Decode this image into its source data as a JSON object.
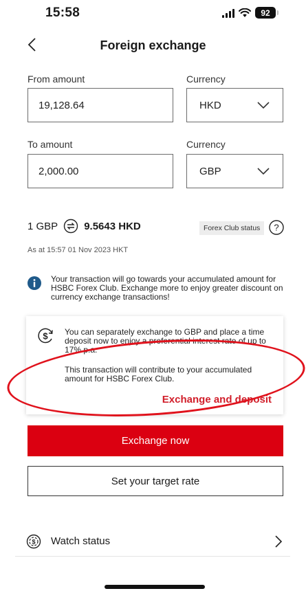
{
  "status_bar": {
    "time": "15:58",
    "battery": "92"
  },
  "header": {
    "title": "Foreign exchange"
  },
  "from": {
    "label": "From amount",
    "value": "19,128.64",
    "currency_label": "Currency",
    "currency": "HKD"
  },
  "to": {
    "label": "To amount",
    "value": "2,000.00",
    "currency_label": "Currency",
    "currency": "GBP"
  },
  "rate": {
    "from": "1 GBP",
    "to": "9.5643 HKD",
    "as_at": "As at 15:57 01 Nov 2023 HKT",
    "club_status": "Forex Club status"
  },
  "info": {
    "text": "Your transaction will go towards your accumulated amount for HSBC Forex Club. Exchange more to enjoy greater discount on currency exchange transactions!"
  },
  "promo": {
    "text1": "You can separately exchange to GBP and place a time deposit now to enjoy a preferential interest rate of up to 17% p.a.",
    "text2": "This transaction will contribute to your accumulated amount for HSBC Forex Club.",
    "link": "Exchange and deposit"
  },
  "buttons": {
    "exchange_now": "Exchange now",
    "target_rate": "Set your target rate"
  },
  "watch": {
    "label": "Watch status"
  },
  "colors": {
    "accent": "#db0011",
    "annotation": "#e0121c",
    "info_icon": "#1f5a8a"
  },
  "icons": [
    "back-chevron-icon",
    "swap-icon",
    "help-icon",
    "info-icon",
    "dollar-exchange-icon",
    "watch-status-icon",
    "chevron-right-icon",
    "chevron-down-icon"
  ]
}
